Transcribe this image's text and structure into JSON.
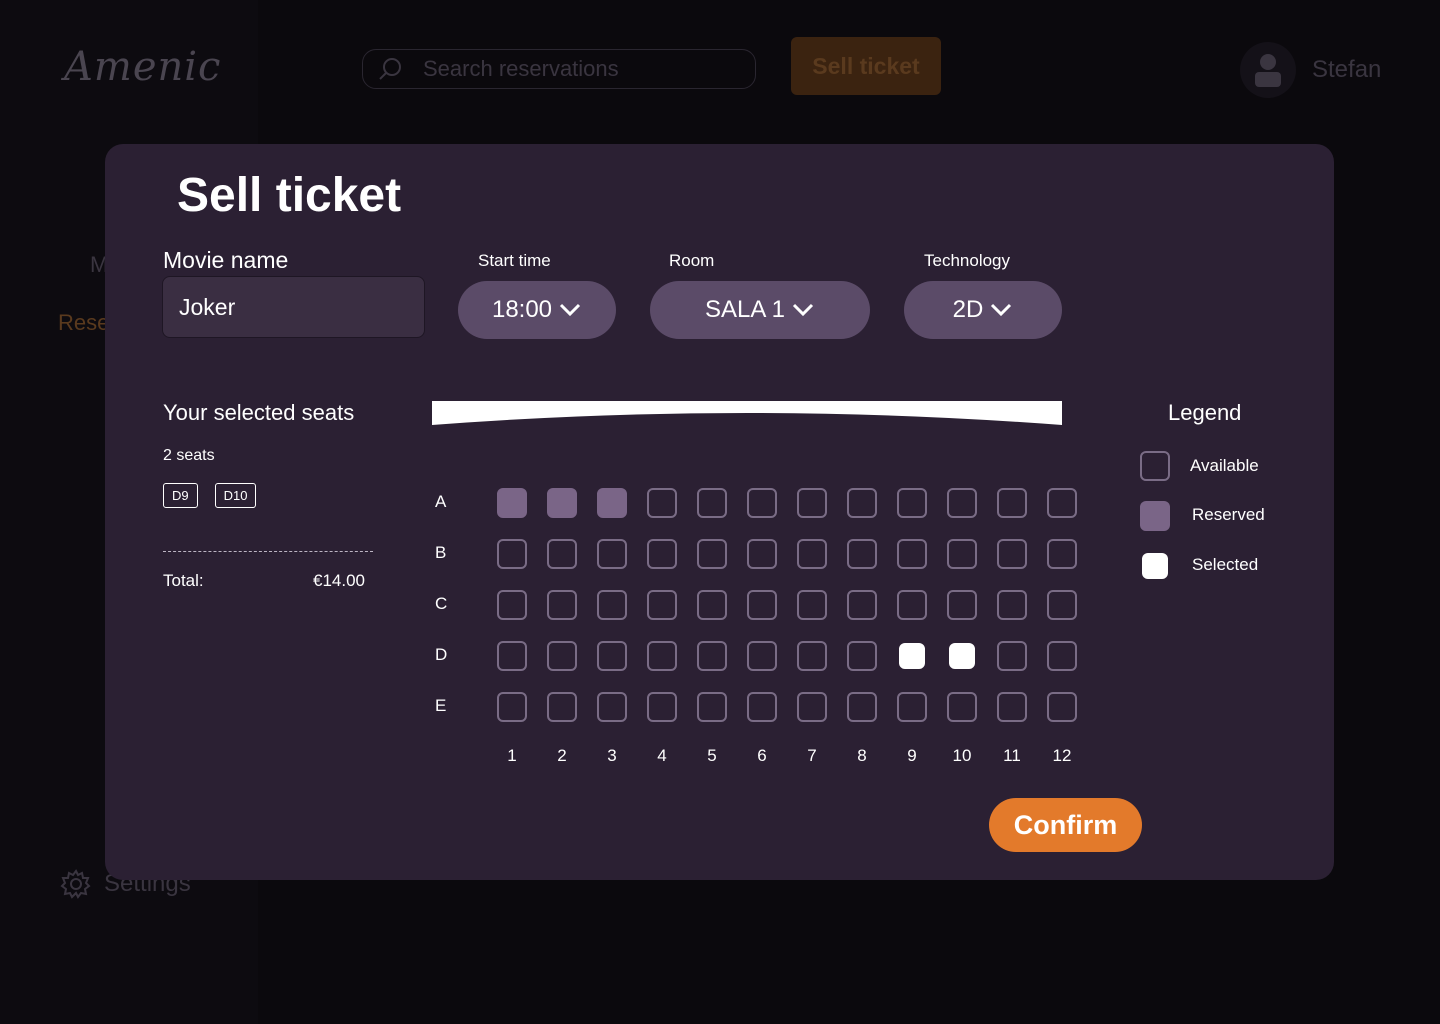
{
  "app": {
    "logo": "Amenic",
    "nav": {
      "item_partial": "M",
      "active_partial": "Rese",
      "settings": "Settings"
    },
    "search": {
      "placeholder": "Search reservations"
    },
    "sell_button": "Sell ticket",
    "user": {
      "name": "Stefan"
    }
  },
  "modal": {
    "title": "Sell ticket",
    "movie": {
      "label": "Movie name",
      "value": "Joker"
    },
    "start_time": {
      "label": "Start time",
      "value": "18:00"
    },
    "room": {
      "label": "Room",
      "value": "SALA 1"
    },
    "technology": {
      "label": "Technology",
      "value": "2D"
    },
    "selection": {
      "title": "Your selected seats",
      "count": "2 seats",
      "seats": [
        "D9",
        "D10"
      ],
      "total_label": "Total:",
      "total_value": "€14.00"
    },
    "seatmap": {
      "rows": [
        "A",
        "B",
        "C",
        "D",
        "E"
      ],
      "columns": [
        "1",
        "2",
        "3",
        "4",
        "5",
        "6",
        "7",
        "8",
        "9",
        "10",
        "11",
        "12"
      ],
      "reserved": [
        "A1",
        "A2",
        "A3"
      ],
      "selected": [
        "D9",
        "D10"
      ]
    },
    "legend": {
      "title": "Legend",
      "available": "Available",
      "reserved": "Reserved",
      "selected": "Selected"
    },
    "confirm": "Confirm"
  },
  "colors": {
    "modal_bg": "#2b2033",
    "select_bg": "#5b4b68",
    "reserved": "#7a6587",
    "accent": "#e37a2b"
  }
}
